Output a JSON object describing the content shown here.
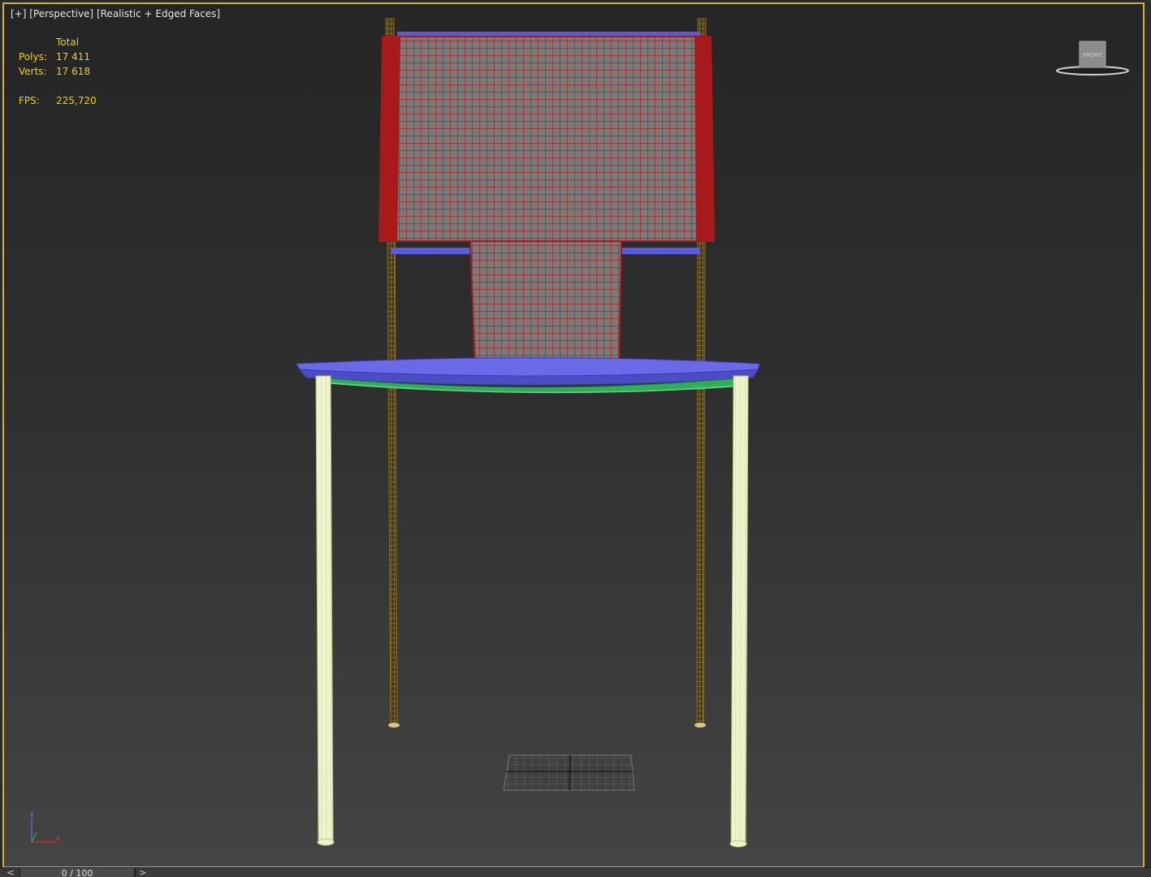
{
  "viewport": {
    "label_plus": "[+]",
    "label_view": "[Perspective]",
    "label_shading": "[Realistic + Edged Faces]"
  },
  "stats": {
    "header": "Total",
    "polys_label": "Polys:",
    "polys_value": "17 411",
    "verts_label": "Verts:",
    "verts_value": "17 618",
    "fps_label": "FPS:",
    "fps_value": "225,720"
  },
  "viewcube": {
    "face_label": "FRONT"
  },
  "axis": {
    "z": "z",
    "x": "x"
  },
  "timeline": {
    "prev": "<",
    "next": ">",
    "frame_display": "0 / 100",
    "current_frame": 0,
    "total_frames": 100
  },
  "colors": {
    "frame_border": "#d8b01a",
    "backrest": "#a8191c",
    "rail": "#5a5ae0",
    "seat_edge": "#6a6ae8",
    "seat_frame": "#2fae5a",
    "rear_leg": "#b89420",
    "front_leg": "#dfe8b0",
    "stats_text": "#f0d000"
  }
}
